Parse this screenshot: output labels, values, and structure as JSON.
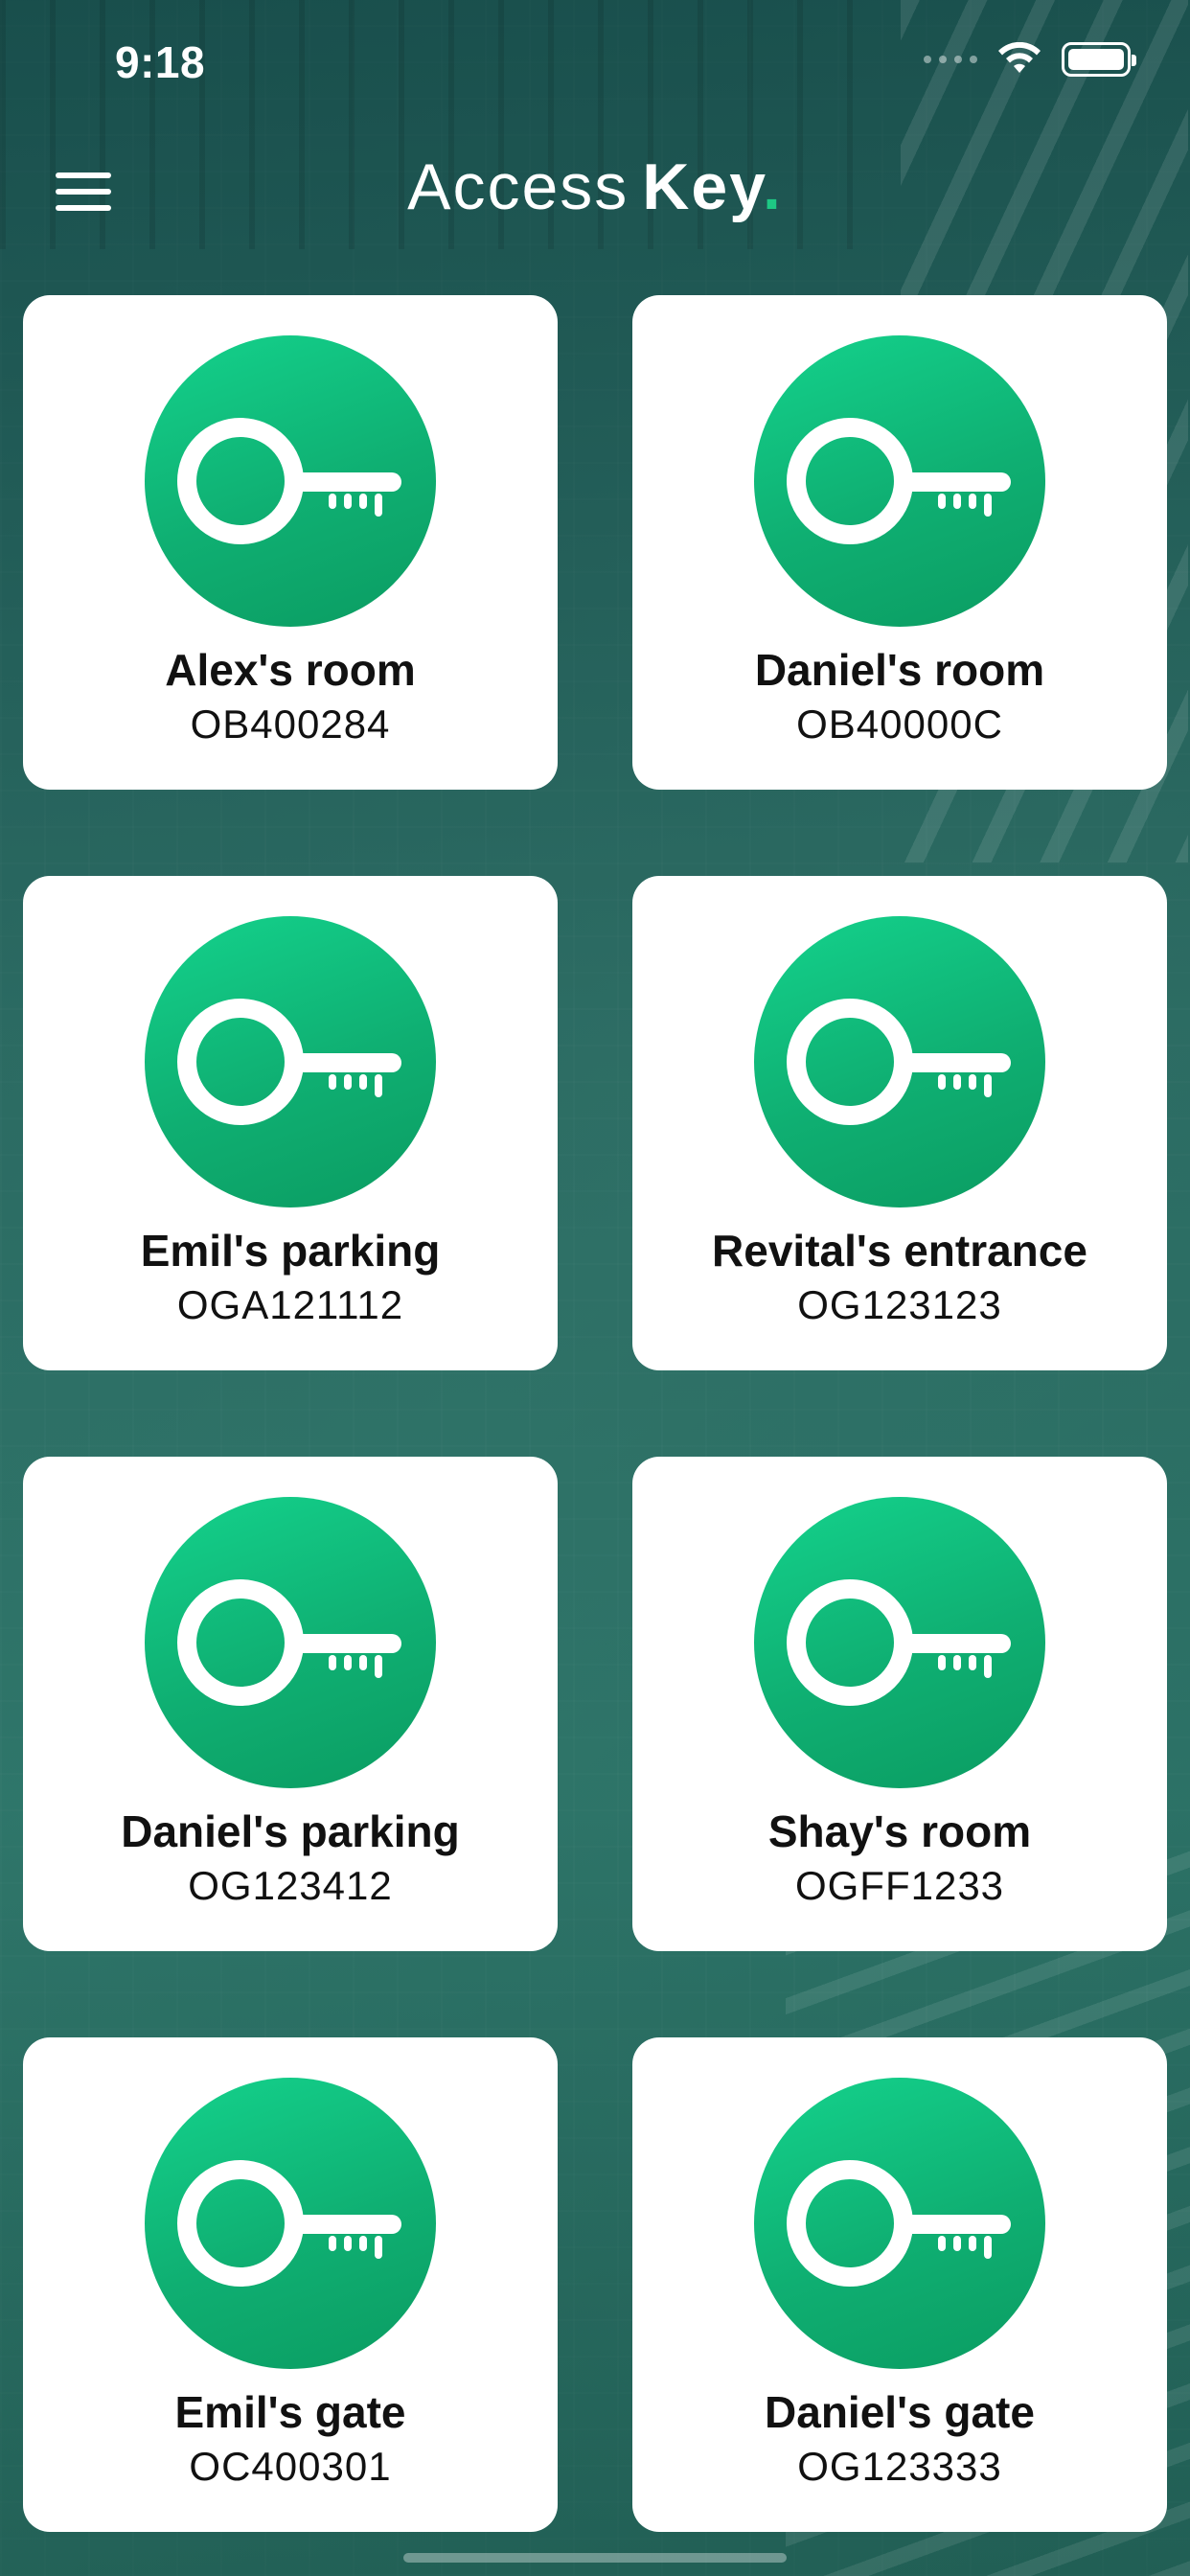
{
  "status_bar": {
    "time": "9:18"
  },
  "header": {
    "title_light": "Access",
    "title_bold": "Key",
    "title_dot": ".",
    "menu_icon": "hamburger-menu-icon"
  },
  "colors": {
    "accent": "#14C882",
    "card_bg": "#FFFFFF",
    "text": "#111111"
  },
  "keys": [
    {
      "name": "Alex's room",
      "code": "OB400284",
      "icon": "key-icon"
    },
    {
      "name": "Daniel's room",
      "code": "OB40000C",
      "icon": "key-icon"
    },
    {
      "name": "Emil's parking",
      "code": "OGA121112",
      "icon": "key-icon"
    },
    {
      "name": "Revital's entrance",
      "code": "OG123123",
      "icon": "key-icon"
    },
    {
      "name": "Daniel's parking",
      "code": "OG123412",
      "icon": "key-icon"
    },
    {
      "name": "Shay's room",
      "code": "OGFF1233",
      "icon": "key-icon"
    },
    {
      "name": "Emil's gate",
      "code": "OC400301",
      "icon": "key-icon"
    },
    {
      "name": "Daniel's gate",
      "code": "OG123333",
      "icon": "key-icon"
    }
  ]
}
